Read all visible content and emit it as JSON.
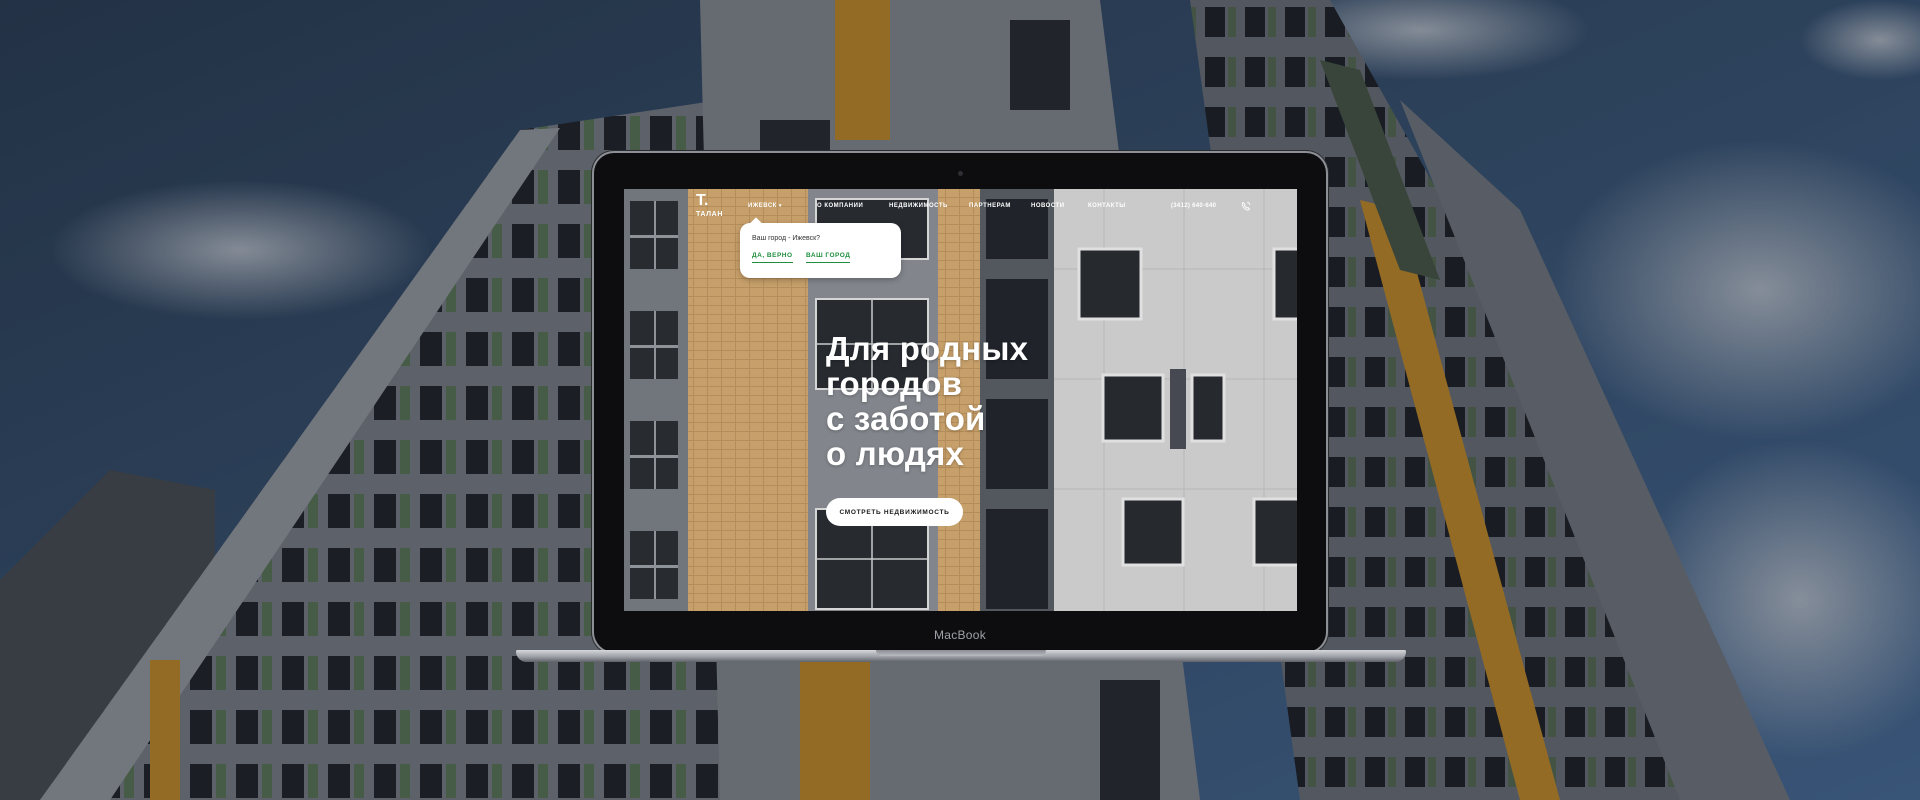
{
  "device": {
    "brand_label": "MacBook"
  },
  "site": {
    "logo": {
      "mark": "T.",
      "text": "ТАЛАН"
    },
    "nav": {
      "city": "ИЖЕВСК",
      "items": [
        "О КОМПАНИИ",
        "НЕДВИЖИМОСТЬ",
        "ПАРТНЕРАМ",
        "НОВОСТИ",
        "КОНТАКТЫ"
      ]
    },
    "phone": "(3412) 640-640",
    "city_popup": {
      "question": "Ваш город - Ижевск?",
      "confirm_label": "ДА, ВЕРНО",
      "choose_label": "ВАШ ГОРОД"
    },
    "hero": {
      "title_lines": [
        "Для родных",
        "городов",
        "с заботой",
        "о людях"
      ],
      "cta_label": "СМОТРЕТЬ НЕДВИЖИМОСТЬ"
    }
  },
  "colors": {
    "accent_green": "#1e8e3e",
    "facade_orange": "#d4a15a",
    "sky_blue": "#3f5e86"
  },
  "icons": {
    "city_chevron": "chevron-down-icon",
    "callback": "phone-callback-icon"
  }
}
